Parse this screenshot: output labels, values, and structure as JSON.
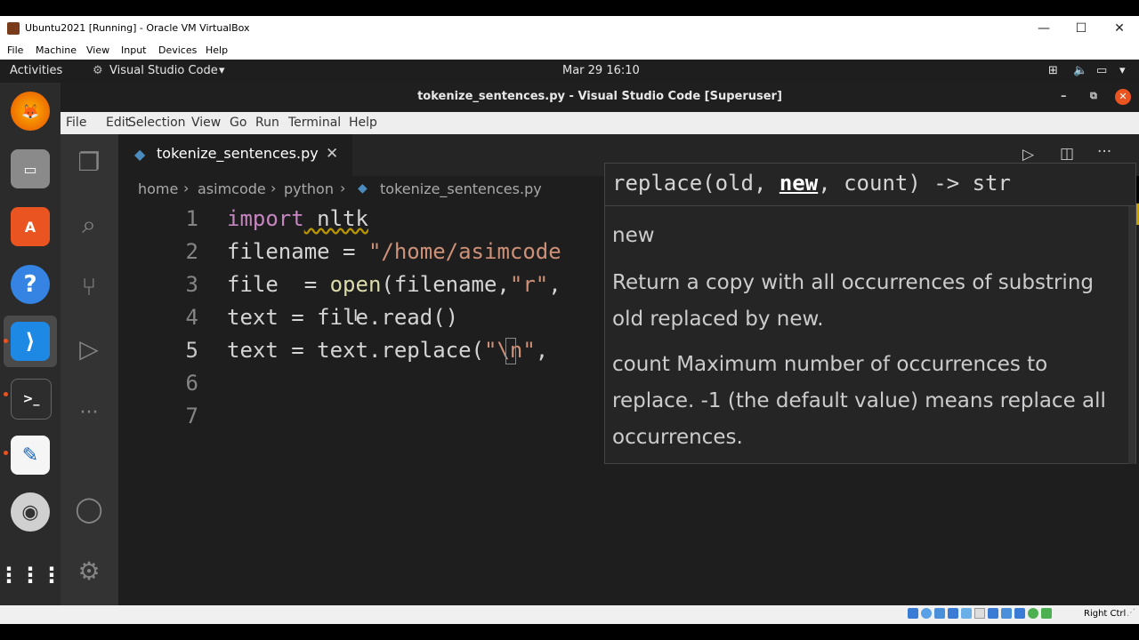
{
  "vbox": {
    "title": "Ubuntu2021 [Running] - Oracle VM VirtualBox",
    "menu": [
      "File",
      "Machine",
      "View",
      "Input",
      "Devices",
      "Help"
    ],
    "minimize": "—",
    "maximize": "☐",
    "close": "✕",
    "status_text": "Right Ctrl"
  },
  "gnome": {
    "activities": "Activities",
    "app_menu": "Visual Studio Code",
    "clock": "Mar 29  16:10"
  },
  "vscode": {
    "window_title": "tokenize_sentences.py - Visual Studio Code [Superuser]",
    "menu": [
      "File",
      "Edit",
      "Selection",
      "View",
      "Go",
      "Run",
      "Terminal",
      "Help"
    ],
    "tab_label": "tokenize_sentences.py",
    "breadcrumb": [
      "home",
      "asimcode",
      "python",
      "tokenize_sentences.py"
    ],
    "line_numbers": [
      "1",
      "2",
      "3",
      "4",
      "5",
      "6",
      "7"
    ],
    "code": {
      "l1_kw": "import",
      "l1_rest": " nltk",
      "l2_a": "filename = ",
      "l2_str": "\"/home/asimcode",
      "l3_a": "file  = ",
      "l3_fn": "open",
      "l3_b": "(filename,",
      "l3_str": "\"r\"",
      "l3_c": ",",
      "l4": "text = file.read()",
      "l5_a": "text = text.replace(",
      "l5_str": "\"\\n\"",
      "l5_b": ","
    },
    "hover": {
      "sig_pre": "replace(old, ",
      "sig_param": "new",
      "sig_post": ", count) -> str",
      "param": "new",
      "desc1": "Return a copy with all occurrences of substring old replaced by new.",
      "desc2": "count Maximum number of occurrences to replace. -1 (the default value) means replace all occurrences."
    }
  }
}
